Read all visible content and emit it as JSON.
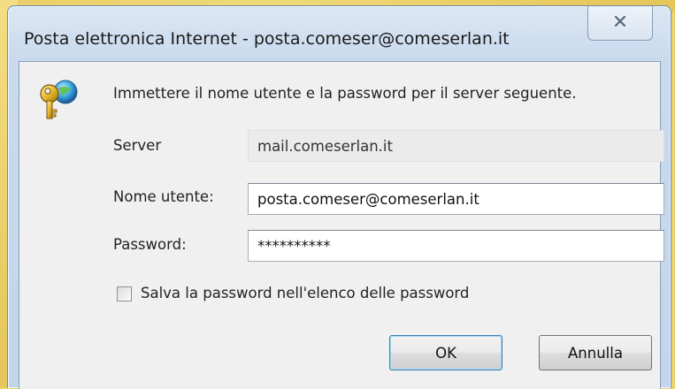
{
  "dialog": {
    "title": "Posta elettronica Internet - posta.comeser@comeserlan.it",
    "close_glyph": "☒",
    "icon": "key-icon",
    "prompt": "Immettere il nome utente e la password per il server seguente.",
    "server": {
      "label": "Server",
      "value": "mail.comeserlan.it"
    },
    "username": {
      "label": "Nome utente:",
      "value": "posta.comeser@comeserlan.it"
    },
    "password": {
      "label": "Password:",
      "value": "**********"
    },
    "save_password": {
      "label": "Salva la password nell'elenco delle password",
      "checked": false
    },
    "ok_label": "OK",
    "cancel_label": "Annulla"
  },
  "colors": {
    "frame": "#c9daee",
    "client": "#f0f0f0",
    "default_button_border": "#3c7fb1"
  }
}
